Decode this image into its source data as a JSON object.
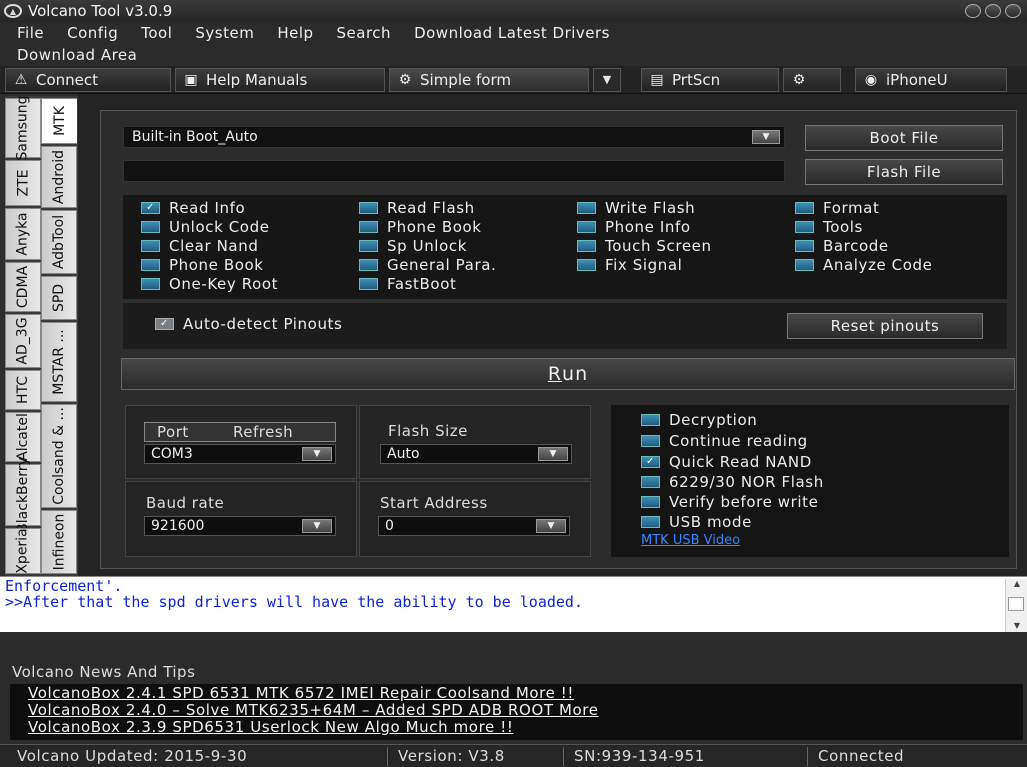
{
  "window": {
    "title": "Volcano Tool v3.0.9"
  },
  "menu": {
    "items": [
      "File",
      "Config",
      "Tool",
      "System",
      "Help",
      "Search",
      "Download Latest Drivers"
    ],
    "row2": [
      "Download Area"
    ]
  },
  "toolbar": {
    "connect": "Connect",
    "help": "Help Manuals",
    "simple": "Simple form",
    "prtscn": "PrtScn",
    "iphone": "iPhoneU"
  },
  "tabs": {
    "outer": [
      "Samsung",
      "ZTE",
      "Anyka",
      "CDMA",
      "AD_3G",
      "HTC",
      "Alcatel",
      "BlackBerry",
      "Xperia"
    ],
    "inner": [
      "MTK",
      "Android",
      "AdbTool",
      "SPD",
      "MSTAR ...",
      "Coolsand & ...",
      "Infineon"
    ]
  },
  "boot": {
    "selected": "Built-in Boot_Auto",
    "file_path": "",
    "boot_btn": "Boot File",
    "flash_btn": "Flash File"
  },
  "checks": [
    {
      "label": "Read Info",
      "checked": true
    },
    {
      "label": "Read Flash",
      "checked": false
    },
    {
      "label": "Write Flash",
      "checked": false
    },
    {
      "label": "Format",
      "checked": false
    },
    {
      "label": "Unlock Code",
      "checked": false
    },
    {
      "label": "Phone Book",
      "checked": false
    },
    {
      "label": "Phone Info",
      "checked": false
    },
    {
      "label": "Tools",
      "checked": false
    },
    {
      "label": "Clear Nand",
      "checked": false
    },
    {
      "label": "Sp Unlock",
      "checked": false
    },
    {
      "label": "Touch Screen",
      "checked": false
    },
    {
      "label": "Barcode",
      "checked": false
    },
    {
      "label": "Phone Book",
      "checked": false
    },
    {
      "label": "General Para.",
      "checked": false
    },
    {
      "label": "Fix Signal",
      "checked": false
    },
    {
      "label": "Analyze Code",
      "checked": false
    },
    {
      "label": "One-Key Root",
      "checked": false
    },
    {
      "label": "FastBoot",
      "checked": false
    }
  ],
  "pinouts": {
    "auto_label": "Auto-detect Pinouts",
    "auto_checked": true,
    "reset_btn": "Reset pinouts"
  },
  "run": {
    "label_u": "R",
    "label_rest": "un"
  },
  "port": {
    "label": "Port",
    "refresh": "Refresh",
    "value": "COM3"
  },
  "flash_size": {
    "label": "Flash Size",
    "value": "Auto"
  },
  "baud": {
    "label": "Baud rate",
    "value": "921600"
  },
  "start_addr": {
    "label": "Start Address",
    "value": "0"
  },
  "options": [
    {
      "label": "Decryption",
      "checked": false
    },
    {
      "label": "Continue reading",
      "checked": false
    },
    {
      "label": "Quick Read NAND",
      "checked": true
    },
    {
      "label": "6229/30 NOR Flash",
      "checked": false
    },
    {
      "label": "Verify before write",
      "checked": false
    },
    {
      "label": "USB mode",
      "checked": false
    }
  ],
  "video_link": "MTK USB Video",
  "log": {
    "line1": "Enforcement'.",
    "line2": ">>After that the spd drivers will have the ability to be loaded."
  },
  "news": {
    "title": "Volcano News And Tips",
    "items": [
      "VolcanoBox 2.4.1 SPD 6531  MTK 6572 IMEI Repair  Coolsand  More !!",
      "VolcanoBox 2.4.0 – Solve MTK6235+64M – Added SPD ADB ROOT  More",
      "VolcanoBox 2.3.9 SPD6531 Userlock New Algo  Much more !!"
    ]
  },
  "status": {
    "updated": "Volcano Updated: 2015-9-30",
    "version": "Version: V3.8",
    "sn": "SN:939-134-951",
    "state": "Connected"
  },
  "colors": {
    "link": "#3a84ff",
    "log_text": "#0d23d6",
    "checkbox": "#2a7aa0"
  }
}
